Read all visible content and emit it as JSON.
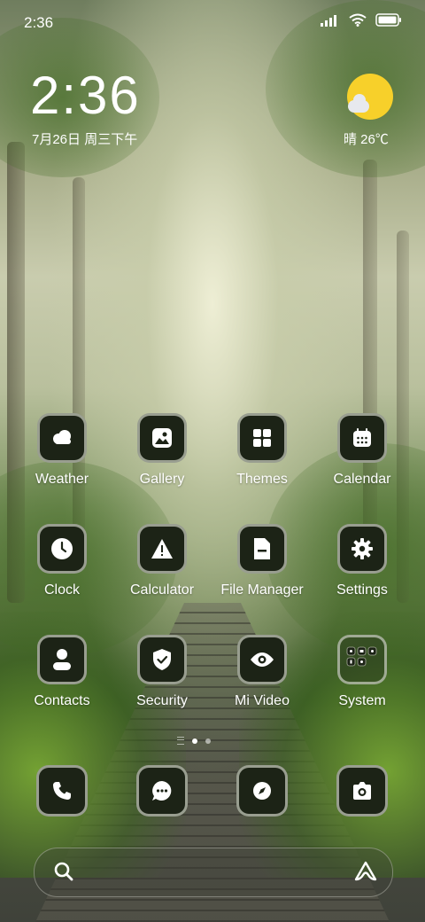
{
  "status_bar": {
    "time": "2:36",
    "icons": [
      "signal-icon",
      "wifi-icon",
      "battery-icon"
    ]
  },
  "clock_widget": {
    "time": "2:36",
    "date": "7月26日 周三下午"
  },
  "weather_widget": {
    "condition_icon": "sunny-cloud-icon",
    "text": "晴 26℃"
  },
  "apps": [
    {
      "label": "Weather",
      "icon": "weather-icon"
    },
    {
      "label": "Gallery",
      "icon": "gallery-icon"
    },
    {
      "label": "Themes",
      "icon": "themes-icon"
    },
    {
      "label": "Calendar",
      "icon": "calendar-icon"
    },
    {
      "label": "Clock",
      "icon": "clock-icon"
    },
    {
      "label": "Calculator",
      "icon": "calculator-icon"
    },
    {
      "label": "File Manager",
      "icon": "file-manager-icon"
    },
    {
      "label": "Settings",
      "icon": "settings-icon"
    },
    {
      "label": "Contacts",
      "icon": "contacts-icon"
    },
    {
      "label": "Security",
      "icon": "security-icon"
    },
    {
      "label": "Mi Video",
      "icon": "video-icon"
    },
    {
      "label": "System",
      "icon": "folder-icon"
    }
  ],
  "page_indicator": {
    "pages": 2,
    "active": 1
  },
  "dock": [
    {
      "icon": "phone-icon"
    },
    {
      "icon": "messages-icon"
    },
    {
      "icon": "browser-icon"
    },
    {
      "icon": "camera-icon"
    }
  ],
  "search_bar": {
    "left_icon": "search-icon",
    "right_icon": "assistant-icon"
  },
  "colors": {
    "icon_bg": "#1c2316",
    "sun": "#f7d02a",
    "text": "#ffffff"
  }
}
